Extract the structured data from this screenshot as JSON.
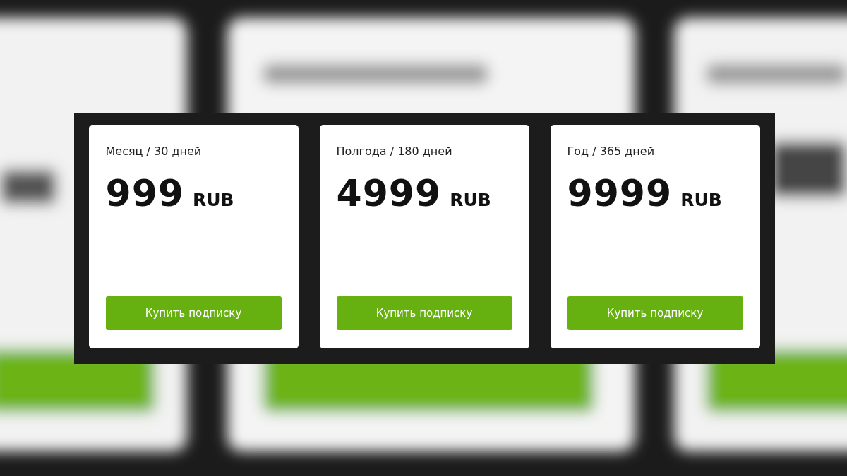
{
  "plans": [
    {
      "period": "Месяц / 30 дней",
      "price": "999",
      "currency": "RUB",
      "button": "Купить подписку"
    },
    {
      "period": "Полгода / 180 дней",
      "price": "4999",
      "currency": "RUB",
      "button": "Купить подписку"
    },
    {
      "period": "Год / 365 дней",
      "price": "9999",
      "currency": "RUB",
      "button": "Купить подписку"
    }
  ]
}
